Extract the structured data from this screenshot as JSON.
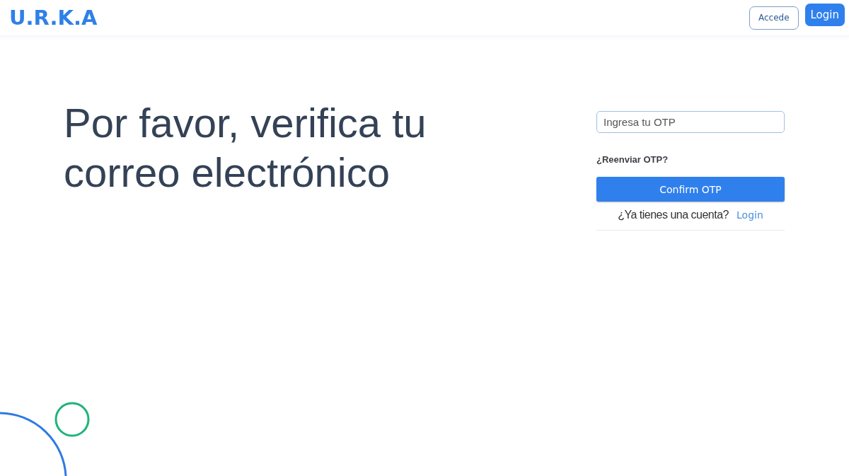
{
  "header": {
    "logo": "U.R.K.A",
    "buttons": [
      {
        "label": "Accede",
        "kind": "outline"
      },
      {
        "label": "Login",
        "kind": "primary"
      }
    ]
  },
  "heading": "Por favor, verifica tu correo electrónico",
  "form": {
    "otp_field": {
      "placeholder": "Ingresa tu OTP"
    },
    "resend_link": "¿Reenviar OTP?",
    "confirm_button": "Confirm OTP",
    "account_prompt": "¿Ya tienes una cuenta?",
    "login_link": "Login"
  }
}
